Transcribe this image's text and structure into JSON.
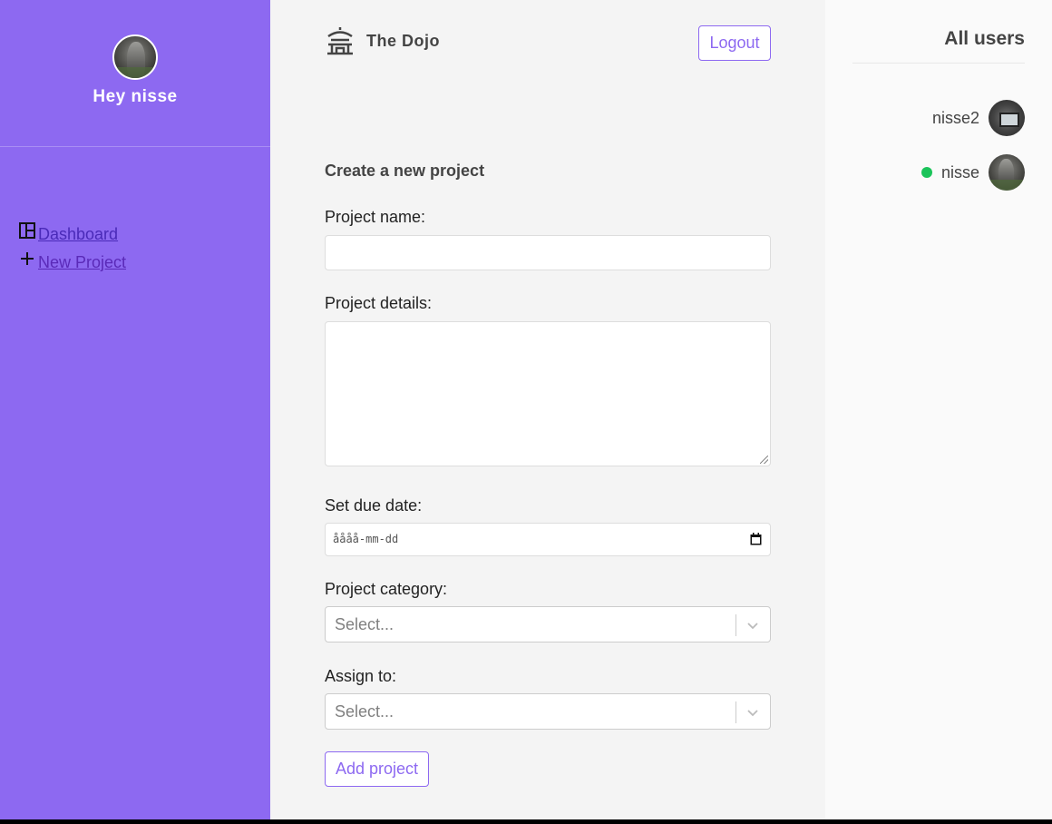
{
  "sidebar": {
    "greeting": "Hey nisse",
    "nav": [
      {
        "label": "Dashboard",
        "icon": "dashboard-icon"
      },
      {
        "label": "New Project",
        "icon": "plus-icon"
      }
    ],
    "bg_color": "#8d69f1"
  },
  "header": {
    "brand": "The Dojo",
    "logo_icon": "temple-icon",
    "logout_label": "Logout"
  },
  "form": {
    "title": "Create a new project",
    "name_label": "Project name:",
    "name_value": "",
    "details_label": "Project details:",
    "details_value": "",
    "due_label": "Set due date:",
    "due_placeholder": "åååå-mm-dd",
    "category_label": "Project category:",
    "category_placeholder": "Select...",
    "assign_label": "Assign to:",
    "assign_placeholder": "Select...",
    "submit_label": "Add project"
  },
  "users_panel": {
    "title": "All users",
    "users": [
      {
        "name": "nisse2",
        "online": false
      },
      {
        "name": "nisse",
        "online": true
      }
    ]
  },
  "colors": {
    "accent": "#8d69f1",
    "online": "#1bc45a"
  }
}
